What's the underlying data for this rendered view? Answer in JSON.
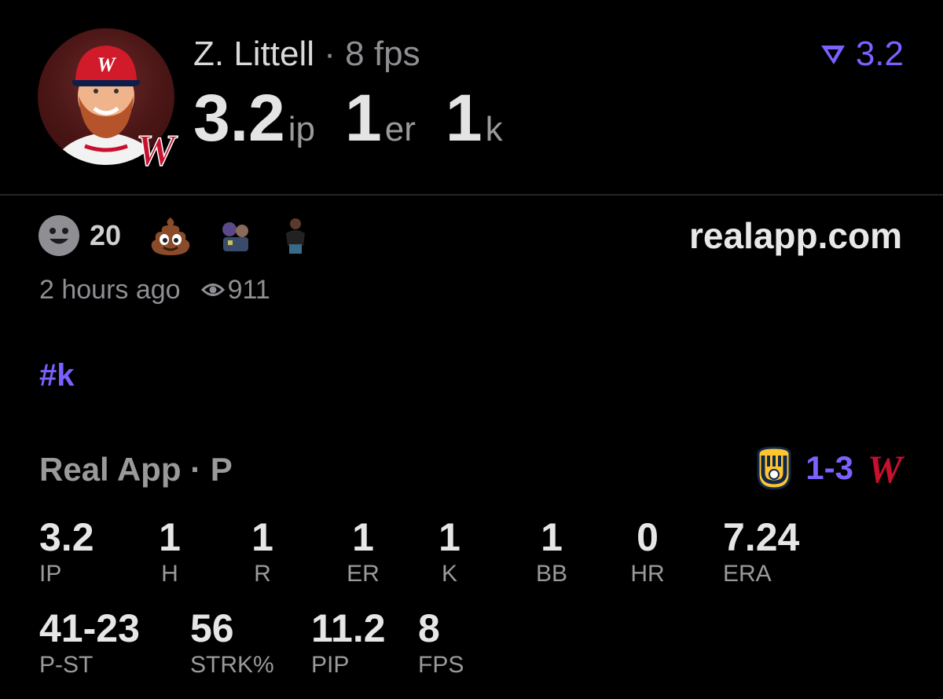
{
  "header": {
    "player_name": "Z. Littell",
    "separator": "·",
    "fps_text": "8 fps",
    "statline": [
      {
        "value": "3.2",
        "unit": "ip"
      },
      {
        "value": "1",
        "unit": "er"
      },
      {
        "value": "1",
        "unit": "k"
      }
    ],
    "rating": "3.2",
    "team_logo_letter": "W"
  },
  "reactions": {
    "count": "20",
    "site": "realapp.com",
    "time_ago": "2 hours ago",
    "views": "911"
  },
  "post": {
    "hashtag": "#k"
  },
  "boxscore": {
    "title": "Real App · P",
    "score": "1-3",
    "stats_row1": [
      {
        "value": "3.2",
        "label": "IP"
      },
      {
        "value": "1",
        "label": "H"
      },
      {
        "value": "1",
        "label": "R"
      },
      {
        "value": "1",
        "label": "ER"
      },
      {
        "value": "1",
        "label": "K"
      },
      {
        "value": "1",
        "label": "BB"
      },
      {
        "value": "0",
        "label": "HR"
      },
      {
        "value": "7.24",
        "label": "ERA"
      }
    ],
    "stats_row2": [
      {
        "value": "41-23",
        "label": "P-ST"
      },
      {
        "value": "56",
        "label": "STRK%"
      },
      {
        "value": "11.2",
        "label": "PIP"
      },
      {
        "value": "8",
        "label": "FPS"
      }
    ]
  },
  "colors": {
    "accent": "#7b61ff",
    "background": "#000000",
    "nationals_red": "#c8102e",
    "brewers_gold": "#ffc52f",
    "brewers_navy": "#12284b"
  }
}
